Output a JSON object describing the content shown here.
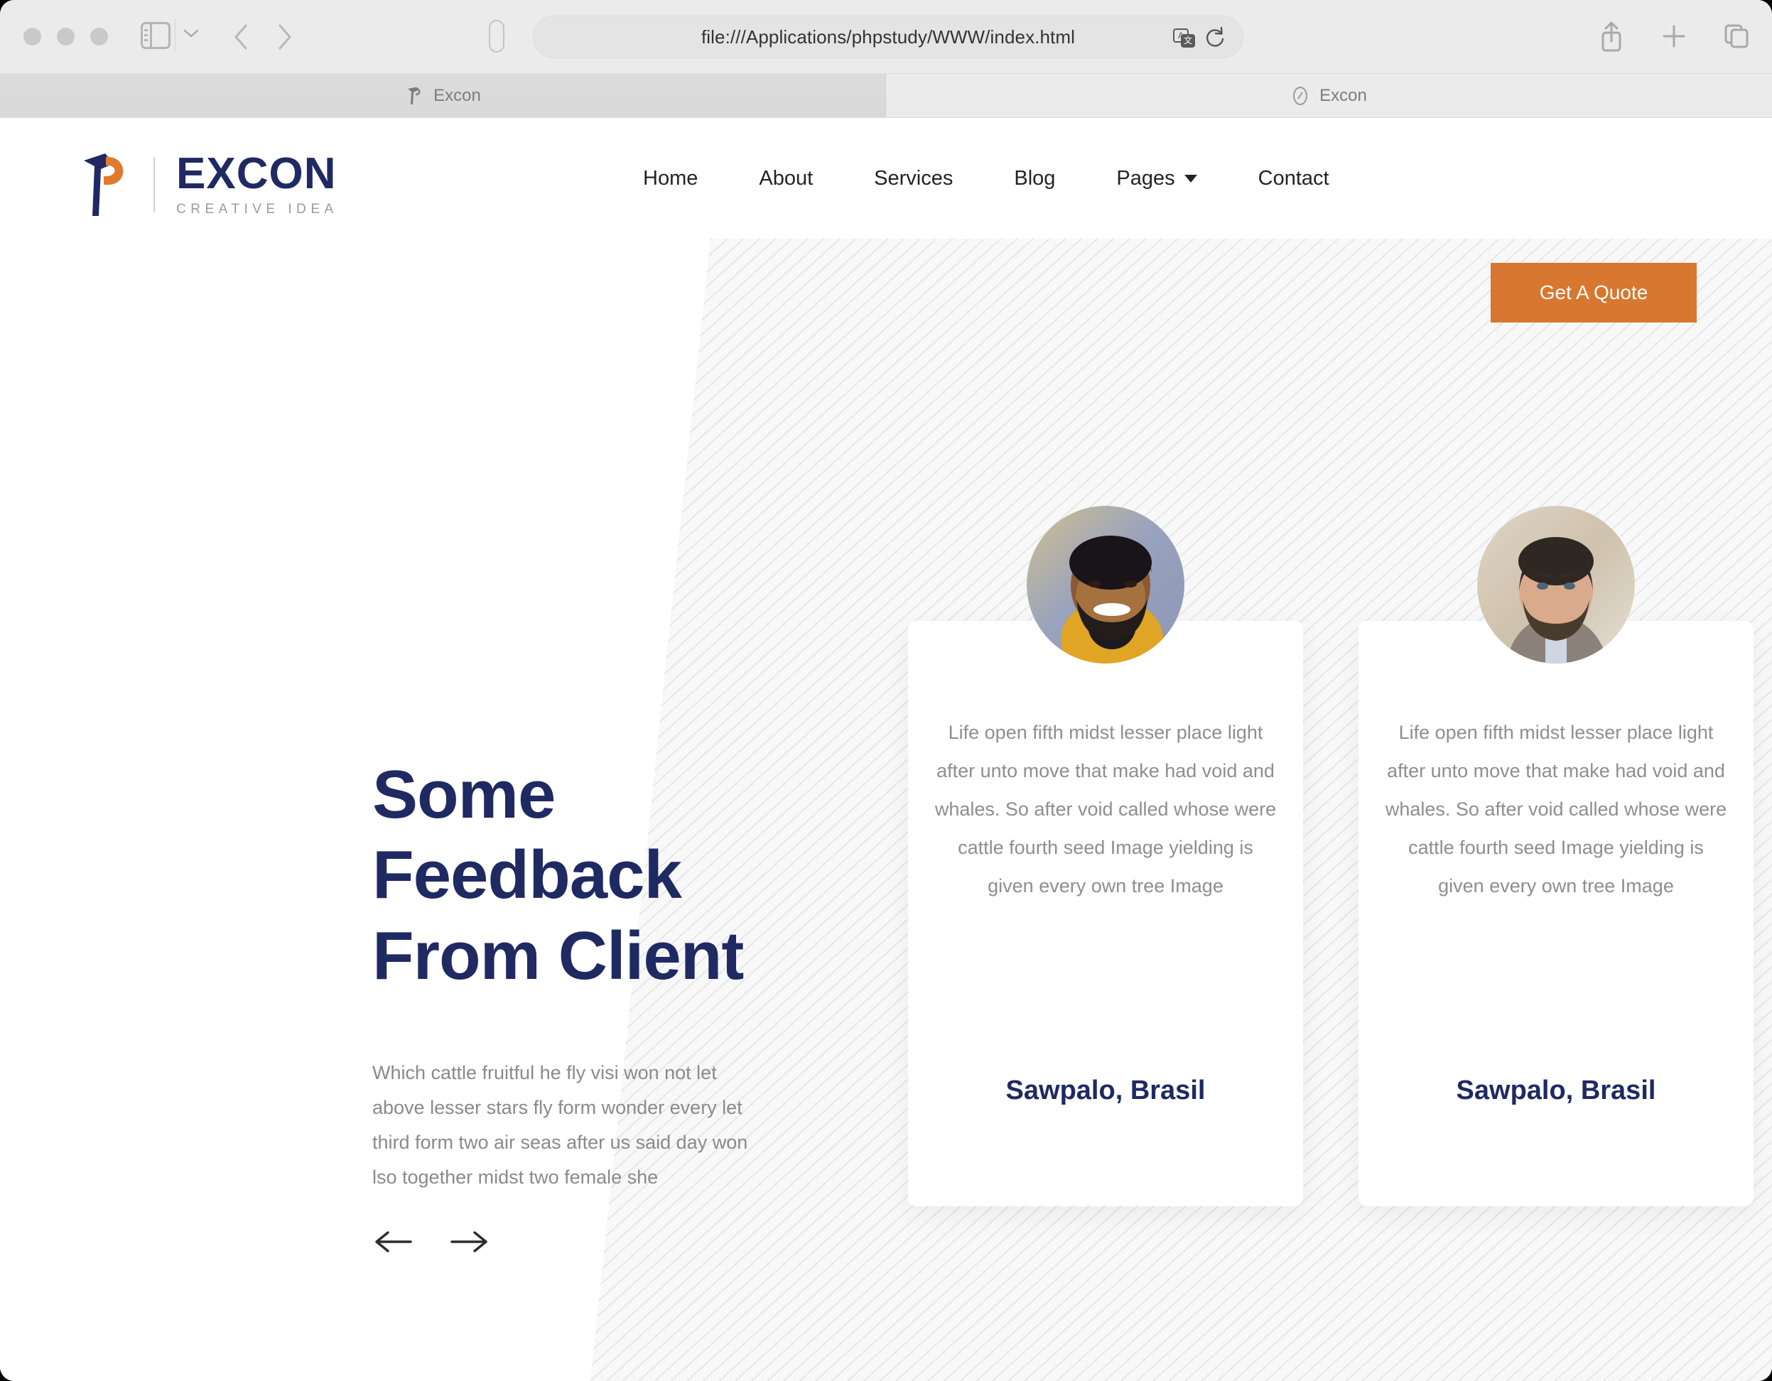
{
  "browser": {
    "url": "file:///Applications/phpstudy/WWW/index.html",
    "tabs": [
      {
        "title": "Excon",
        "active": true,
        "favicon": "hammer-icon"
      },
      {
        "title": "Excon",
        "active": false,
        "favicon": "compass-icon"
      }
    ],
    "toolbar_icons": [
      "sidebar-icon",
      "chevron-down-icon",
      "back-arrow-icon",
      "forward-arrow-icon",
      "shield-icon",
      "translate-icon",
      "reload-icon",
      "share-icon",
      "new-tab-icon",
      "tab-overview-icon"
    ]
  },
  "site": {
    "logo": {
      "mark": "hammer-icon",
      "title": "EXCON",
      "subtitle": "CREATIVE IDEA"
    },
    "nav": [
      {
        "label": "Home",
        "has_dropdown": false
      },
      {
        "label": "About",
        "has_dropdown": false
      },
      {
        "label": "Services",
        "has_dropdown": false
      },
      {
        "label": "Blog",
        "has_dropdown": false
      },
      {
        "label": "Pages",
        "has_dropdown": true
      },
      {
        "label": "Contact",
        "has_dropdown": false
      }
    ],
    "cta": {
      "label": "Get A Quote"
    },
    "hero": {
      "title": "Some Feedback From Client",
      "paragraph": "Which cattle fruitful he fly visi won not let above lesser stars fly form wonder every let third form two air seas after us said day won lso together midst two female she",
      "prev_arrow": "arrow-left-icon",
      "next_arrow": "arrow-right-icon"
    },
    "testimonials": [
      {
        "avatar": "smiling-man-yellow-jacket-avatar",
        "quote": "Life open fifth midst lesser place light after unto move that make had void and whales. So after void called whose were cattle fourth seed Image yielding is given every own tree Image",
        "name": "Sawpalo, Brasil"
      },
      {
        "avatar": "bearded-man-avatar",
        "quote": "Life open fifth midst lesser place light after unto move that make had void and whales. So after void called whose were cattle fourth seed Image yielding is given every own tree Image",
        "name": "Sawpalo, Brasil"
      }
    ]
  },
  "colors": {
    "navy": "#1f2a63",
    "orange": "#d8772f",
    "body_text": "#8a8a8a",
    "stripe_bg": "#f7f7f8"
  }
}
